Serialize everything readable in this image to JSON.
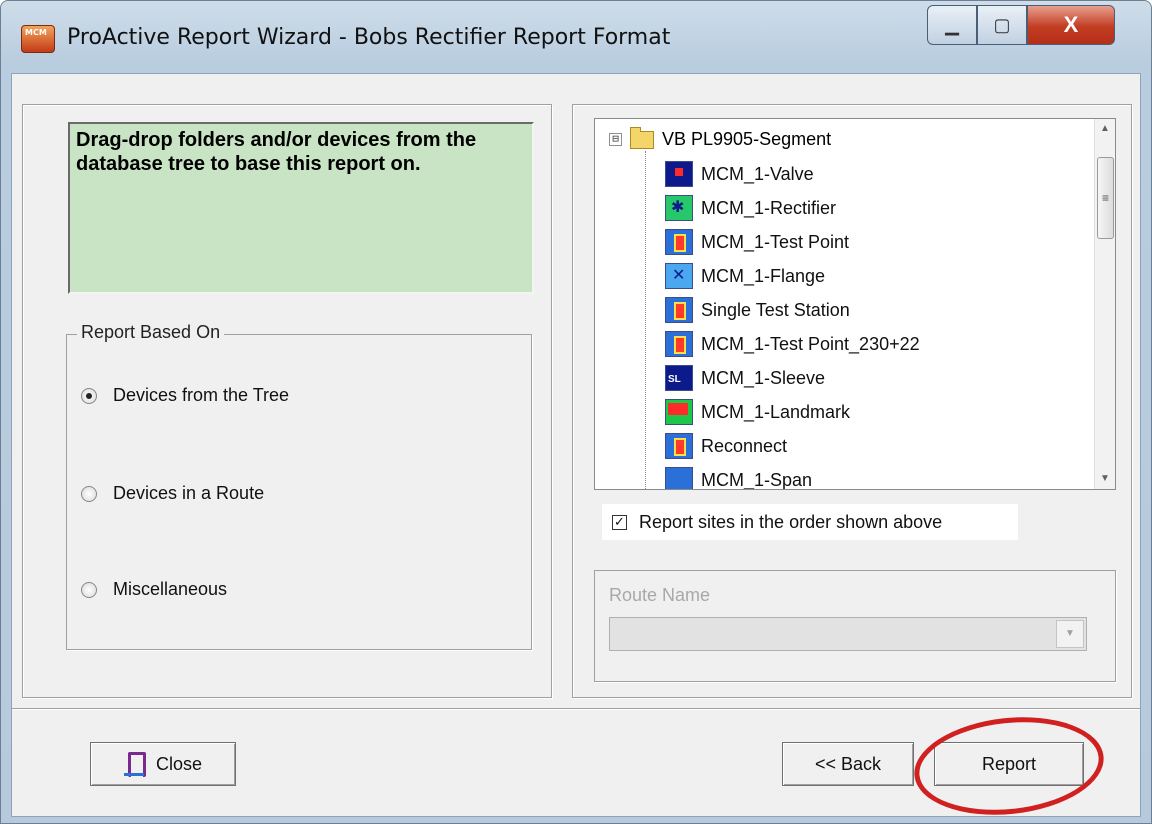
{
  "window": {
    "title": "ProActive Report Wizard - Bobs Rectifier Report Format",
    "app_icon_text": "MCM",
    "caption_buttons": {
      "minimize": "▁",
      "maximize": "▢",
      "close": "X"
    }
  },
  "left": {
    "instruction_text": "Drag-drop folders and/or devices from the database tree to base this report on.",
    "report_based_on": {
      "legend": "Report Based On",
      "options": [
        {
          "label": "Devices from the Tree",
          "selected": true
        },
        {
          "label": "Devices in a Route",
          "selected": false
        },
        {
          "label": "Miscellaneous",
          "selected": false
        }
      ]
    }
  },
  "tree": {
    "root": {
      "expander": "⊟",
      "label": "VB PL9905-Segment",
      "icon": "folder-icon"
    },
    "items": [
      {
        "label": "MCM_1-Valve",
        "icon": "valve-icon"
      },
      {
        "label": "MCM_1-Rectifier",
        "icon": "rectifier-icon"
      },
      {
        "label": "MCM_1-Test Point",
        "icon": "test-point-icon"
      },
      {
        "label": "MCM_1-Flange",
        "icon": "flange-icon"
      },
      {
        "label": "Single Test Station",
        "icon": "test-point-icon"
      },
      {
        "label": "MCM_1-Test Point_230+22",
        "icon": "test-point-icon"
      },
      {
        "label": "MCM_1-Sleeve",
        "icon": "sleeve-icon"
      },
      {
        "label": "MCM_1-Landmark",
        "icon": "landmark-icon"
      },
      {
        "label": "Reconnect",
        "icon": "test-point-icon"
      },
      {
        "label": "MCM_1-Span",
        "icon": "span-icon"
      }
    ],
    "scroll": {
      "up": "▲",
      "down": "▼",
      "thumb": "≡"
    }
  },
  "options": {
    "report_sites_in_order_label": "Report sites in the order shown above",
    "report_sites_in_order_checked": true,
    "check_mark": "✓"
  },
  "route": {
    "label": "Route Name",
    "selected_value": "",
    "arrow": "▼"
  },
  "footer": {
    "close_label": "Close",
    "back_label": "<< Back",
    "report_label": "Report"
  },
  "colors": {
    "instruction_background": "#c8e4c4",
    "highlight_ring": "#d02020"
  }
}
